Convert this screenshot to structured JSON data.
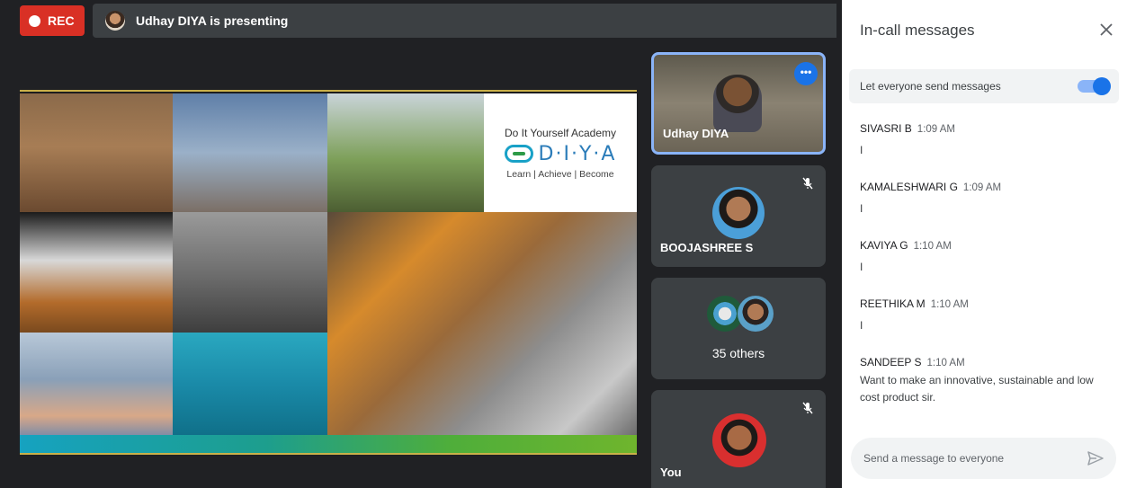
{
  "recording": {
    "label": "REC"
  },
  "presenter_banner": {
    "text": "Udhay DIYA is presenting"
  },
  "slide": {
    "brand_top": "Do It Yourself Academy",
    "brand_name": "D·I·Y·A",
    "brand_tagline": "Learn | Achieve | Become"
  },
  "participants": [
    {
      "name": "Udhay DIYA",
      "role": "presenter"
    },
    {
      "name": "BOOJASHREE S",
      "muted": true
    },
    {
      "name": "35 others"
    },
    {
      "name": "You",
      "muted": true
    }
  ],
  "chat": {
    "title": "In-call messages",
    "toggle_label": "Let everyone send messages",
    "toggle_on": true,
    "messages": [
      {
        "sender": "SIVASRI B",
        "time": "1:09 AM",
        "text": "I"
      },
      {
        "sender": "KAMALESHWARI G",
        "time": "1:09 AM",
        "text": "I"
      },
      {
        "sender": "KAVIYA G",
        "time": "1:10 AM",
        "text": "I"
      },
      {
        "sender": "REETHIKA M",
        "time": "1:10 AM",
        "text": "I"
      },
      {
        "sender": "SANDEEP S",
        "time": "1:10 AM",
        "text": "Want to make an innovative, sustainable and low cost product sir."
      }
    ],
    "input_placeholder": "Send a message to everyone"
  },
  "colors": {
    "rec": "#d93025",
    "accent": "#1a73e8",
    "stage_bg": "#202124",
    "tile_bg": "#3c4043"
  }
}
